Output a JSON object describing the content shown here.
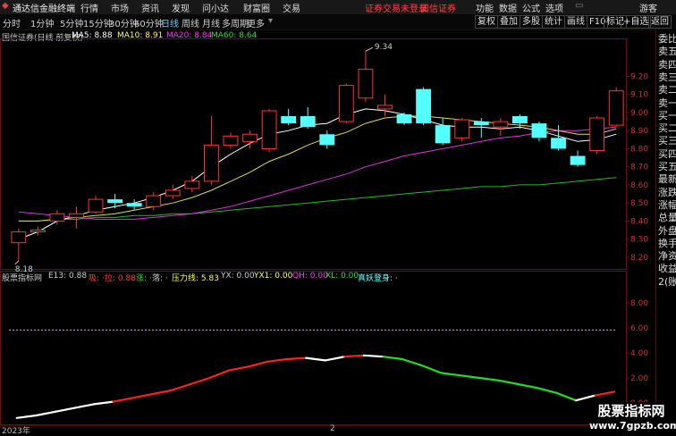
{
  "titlebar": {
    "app_name": "通达信金融终端",
    "menu": [
      "行情",
      "市场",
      "资讯",
      "发现",
      "问小达",
      "财富圈",
      "交易"
    ],
    "notice": "证券交易未登录",
    "broker": "国信证券",
    "right_menu": [
      "功能",
      "数据",
      "公式",
      "选项"
    ],
    "guest": "游客"
  },
  "toolbar": {
    "periods": [
      "分时",
      "1分钟",
      "5分钟",
      "15分钟",
      "30分钟",
      "60分钟",
      "日线",
      "周线",
      "月线",
      "多周期",
      "更多"
    ],
    "active_period": "日线",
    "right_buttons": [
      "复权",
      "叠加",
      "多股",
      "统计",
      "画线",
      "F10",
      "标记",
      "+自选",
      "返回"
    ]
  },
  "main_chart": {
    "title": "国信证券(日线 前复权)",
    "ma_legend": [
      {
        "label": "MA5: 8.88",
        "color": "#ffffff"
      },
      {
        "label": "MA10: 8.91",
        "color": "#ffff55"
      },
      {
        "label": "MA20: 8.84",
        "color": "#ff33ff"
      },
      {
        "label": "MA60: 8.64",
        "color": "#33dd33"
      }
    ],
    "high_label": "9.34",
    "low_label": "8.18",
    "y_ticks": [
      "9.20",
      "9.10",
      "9.00",
      "8.90",
      "8.80",
      "8.70",
      "8.60",
      "8.50",
      "8.40",
      "8.30",
      "8.20"
    ]
  },
  "indicator": {
    "title": "股票指标网",
    "labels": [
      {
        "text": "E13: 0.88",
        "color": "#cccccc"
      },
      {
        "text": "吸: ·",
        "color": "#ff4040"
      },
      {
        "text": "拉: 0.88",
        "color": "#ff4040"
      },
      {
        "text": "涨: ·",
        "color": "#33dd33"
      },
      {
        "text": "落: ·",
        "color": "#cccccc"
      },
      {
        "text": "压力线: 5.83",
        "color": "#ffff55"
      },
      {
        "text": "YX: 0.00",
        "color": "#cccccc"
      },
      {
        "text": "YX1: 0.00",
        "color": "#ffff55"
      },
      {
        "text": "QH: 0.00",
        "color": "#ff33ff"
      },
      {
        "text": "XL: 0.00",
        "color": "#33dd33"
      },
      {
        "text": "真妖登身: ·",
        "color": "#66ffff"
      }
    ],
    "y_ticks": [
      "8.00",
      "6.00",
      "4.00",
      "2.00",
      "0.00"
    ]
  },
  "sidebar": [
    "委比",
    "卖五",
    "卖四",
    "卖三",
    "卖二",
    "卖一",
    "买一",
    "买二",
    "买三",
    "买四",
    "买五",
    "最新",
    "涨跌",
    "涨幅",
    "总量",
    "外盘",
    "换手",
    "净资",
    "收益",
    "2(账)"
  ],
  "bottom": {
    "year": "2023年",
    "month": "2"
  },
  "watermark": {
    "title": "股票指标网",
    "url": "www.7gpzb.com"
  },
  "chart_data": {
    "type": "candlestick",
    "ylim": [
      8.15,
      9.4
    ],
    "candles": [
      [
        8.28,
        8.34,
        8.36,
        8.18
      ],
      [
        8.34,
        8.35,
        8.37,
        8.32
      ],
      [
        8.4,
        8.44,
        8.46,
        8.38
      ],
      [
        8.42,
        8.44,
        8.48,
        8.36
      ],
      [
        8.45,
        8.52,
        8.54,
        8.44
      ],
      [
        8.52,
        8.5,
        8.55,
        8.47
      ],
      [
        8.5,
        8.48,
        8.52,
        8.46
      ],
      [
        8.48,
        8.54,
        8.56,
        8.46
      ],
      [
        8.54,
        8.57,
        8.6,
        8.52
      ],
      [
        8.58,
        8.62,
        8.65,
        8.56
      ],
      [
        8.62,
        8.82,
        8.98,
        8.6
      ],
      [
        8.82,
        8.87,
        8.89,
        8.8
      ],
      [
        8.84,
        8.88,
        8.9,
        8.8
      ],
      [
        8.8,
        9.01,
        9.02,
        8.78
      ],
      [
        8.98,
        8.94,
        9.02,
        8.93
      ],
      [
        8.98,
        8.92,
        9.03,
        8.91
      ],
      [
        8.88,
        8.82,
        8.9,
        8.8
      ],
      [
        8.95,
        9.15,
        9.16,
        8.94
      ],
      [
        9.08,
        9.24,
        9.34,
        9.06
      ],
      [
        9.02,
        9.04,
        9.1,
        8.98
      ],
      [
        8.99,
        8.94,
        9.0,
        8.93
      ],
      [
        9.13,
        8.94,
        9.14,
        8.93
      ],
      [
        8.93,
        8.83,
        8.97,
        8.82
      ],
      [
        8.86,
        8.96,
        8.97,
        8.84
      ],
      [
        8.95,
        8.93,
        8.97,
        8.86
      ],
      [
        8.92,
        8.95,
        8.97,
        8.87
      ],
      [
        8.98,
        8.94,
        8.99,
        8.91
      ],
      [
        8.94,
        8.86,
        8.95,
        8.84
      ],
      [
        8.86,
        8.8,
        8.93,
        8.79
      ],
      [
        8.76,
        8.71,
        8.79,
        8.7
      ],
      [
        8.79,
        8.97,
        8.98,
        8.77
      ],
      [
        8.93,
        9.12,
        9.14,
        8.92
      ]
    ],
    "ma5": [
      8.3,
      8.34,
      8.4,
      8.43,
      8.46,
      8.48,
      8.5,
      8.53,
      8.57,
      8.62,
      8.7,
      8.77,
      8.83,
      8.88,
      8.9,
      8.93,
      8.94,
      8.99,
      9.02,
      9.01,
      8.99,
      8.96,
      8.93,
      8.92,
      8.92,
      8.91,
      8.92,
      8.9,
      8.87,
      8.84,
      8.85,
      8.88
    ],
    "ma10": [
      8.4,
      8.4,
      8.41,
      8.42,
      8.43,
      8.44,
      8.46,
      8.48,
      8.5,
      8.53,
      8.57,
      8.62,
      8.67,
      8.73,
      8.77,
      8.82,
      8.86,
      8.89,
      8.94,
      8.97,
      8.98,
      8.98,
      8.97,
      8.96,
      8.95,
      8.94,
      8.93,
      8.92,
      8.9,
      8.88,
      8.88,
      8.91
    ],
    "ma20": [
      8.45,
      8.44,
      8.43,
      8.42,
      8.41,
      8.41,
      8.41,
      8.42,
      8.43,
      8.44,
      8.46,
      8.48,
      8.51,
      8.54,
      8.57,
      8.6,
      8.63,
      8.66,
      8.7,
      8.73,
      8.76,
      8.78,
      8.8,
      8.82,
      8.84,
      8.86,
      8.87,
      8.89,
      8.9,
      8.9,
      8.91,
      8.92
    ],
    "ma60": [
      8.4,
      8.4,
      8.41,
      8.41,
      8.42,
      8.42,
      8.43,
      8.43,
      8.44,
      8.44,
      8.45,
      8.46,
      8.47,
      8.48,
      8.49,
      8.5,
      8.51,
      8.52,
      8.53,
      8.54,
      8.55,
      8.56,
      8.57,
      8.58,
      8.59,
      8.59,
      8.6,
      8.6,
      8.61,
      8.62,
      8.63,
      8.64
    ],
    "indicator_ylim": [
      -1.5,
      9.5
    ],
    "indicator_line": [
      -1.2,
      -1.0,
      -0.7,
      -0.4,
      -0.1,
      0.1,
      0.4,
      0.7,
      1.0,
      1.5,
      2.0,
      2.6,
      2.9,
      3.3,
      3.5,
      3.6,
      3.4,
      3.7,
      3.8,
      3.7,
      3.5,
      3.0,
      2.4,
      2.2,
      2.0,
      1.8,
      1.5,
      1.2,
      0.8,
      0.2,
      0.6,
      0.9
    ],
    "indicator_colors": [
      "#ffffff",
      "#ffffff",
      "#ffffff",
      "#ffffff",
      "#ffffff",
      "#ff2020",
      "#ff2020",
      "#ff2020",
      "#ff2020",
      "#ff2020",
      "#ff2020",
      "#ff2020",
      "#ff2020",
      "#ff2020",
      "#ff2020",
      "#ffffff",
      "#ffffff",
      "#ff2020",
      "#ffffff",
      "#22dd22",
      "#22dd22",
      "#22dd22",
      "#22dd22",
      "#22dd22",
      "#22dd22",
      "#22dd22",
      "#22dd22",
      "#22dd22",
      "#22dd22",
      "#ffffff",
      "#ff2020",
      "#ff2020"
    ],
    "pressure_line": 5.83
  }
}
